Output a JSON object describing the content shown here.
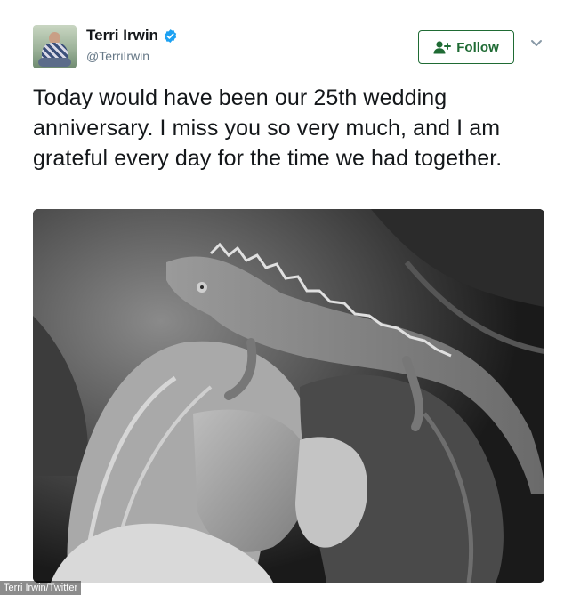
{
  "tweet": {
    "display_name": "Terri Irwin",
    "handle": "@TerriIrwin",
    "follow_label": "Follow",
    "text": "Today would have been our 25th wedding anniversary. I miss you so very much, and I am grateful every day for the time we had together.",
    "icons": [
      "verified-icon",
      "follow-person-icon",
      "chevron-down-icon"
    ],
    "colors": {
      "follow_green": "#1f6b34",
      "verified_blue": "#1da1f2",
      "handle_gray": "#657786"
    }
  },
  "image_credit": "Terri Irwin/Twitter"
}
